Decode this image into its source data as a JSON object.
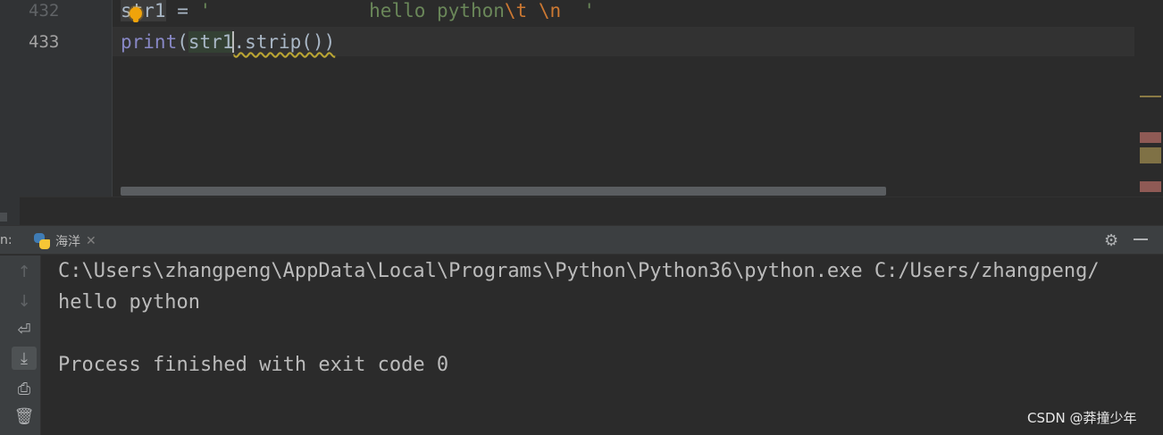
{
  "editor": {
    "lines": [
      {
        "number": "432",
        "var": "str1",
        "op": " = ",
        "str_open": "'              hello python",
        "esc1": "\\t",
        "mid": " ",
        "esc2": "\\n",
        "str_close": "  '"
      },
      {
        "number": "433",
        "fn": "print",
        "open": "(",
        "arg": "str1",
        "rest": ".strip())"
      }
    ]
  },
  "run_panel": {
    "prefix": "n:",
    "tab_label": "海洋",
    "output": [
      "C:\\Users\\zhangpeng\\AppData\\Local\\Programs\\Python\\Python36\\python.exe C:/Users/zhangpeng/",
      "hello python",
      "",
      "Process finished with exit code 0"
    ]
  },
  "icons": {
    "tab": "python-icon",
    "close": "close-icon",
    "settings": "gear-icon",
    "minimize": "minimize-icon",
    "toolbar": [
      "arrow-up-icon",
      "arrow-down-icon",
      "soft-wrap-icon",
      "scroll-to-end-icon",
      "print-icon",
      "trash-icon"
    ]
  },
  "watermark": "CSDN @莽撞少年",
  "colors": {
    "editor_bg": "#2b2b2b",
    "panel_bg": "#3c3f41",
    "string": "#6a8759",
    "escape": "#cc7832",
    "builtin": "#8888c6",
    "text": "#a9b7c6",
    "bulb": "#f0a30a"
  }
}
